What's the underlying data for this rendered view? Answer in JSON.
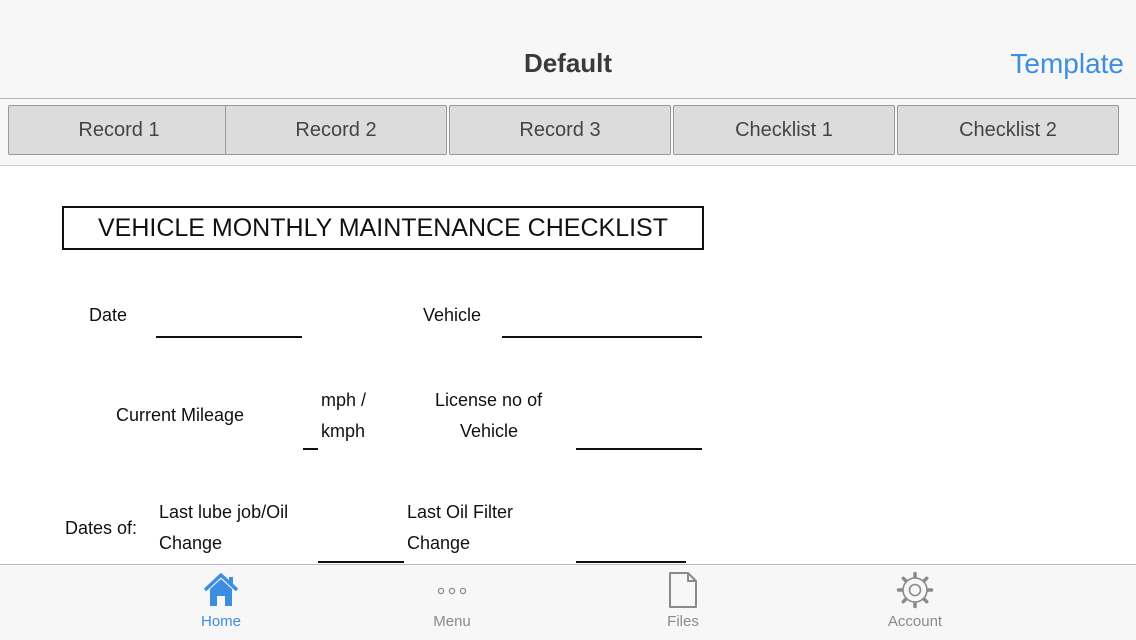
{
  "nav": {
    "title": "Default",
    "right_button": "Template"
  },
  "tabs": [
    "Record 1",
    "Record 2",
    "Record 3",
    "Checklist 1",
    "Checklist 2"
  ],
  "document": {
    "title": "VEHICLE MONTHLY MAINTENANCE CHECKLIST",
    "date_label": "Date",
    "vehicle_label": "Vehicle",
    "mileage_label": "Current Mileage",
    "unit_line1": "mph /",
    "unit_line2": "kmph",
    "license_line1": "License no of",
    "license_line2": "Vehicle",
    "dates_of_label": "Dates of:",
    "lube_line1": "Last lube job/Oil",
    "lube_line2": "Change",
    "filter_line1": "Last Oil Filter",
    "filter_line2": "Change"
  },
  "bottom_tabs": [
    {
      "label": "Home",
      "icon": "home-icon",
      "active": true
    },
    {
      "label": "Menu",
      "icon": "more-icon",
      "active": false
    },
    {
      "label": "Files",
      "icon": "file-icon",
      "active": false
    },
    {
      "label": "Account",
      "icon": "gear-icon",
      "active": false
    }
  ],
  "colors": {
    "accent": "#3d8ee0",
    "inactive": "#8a8a8a",
    "tab_bg": "#dcdcdc"
  }
}
